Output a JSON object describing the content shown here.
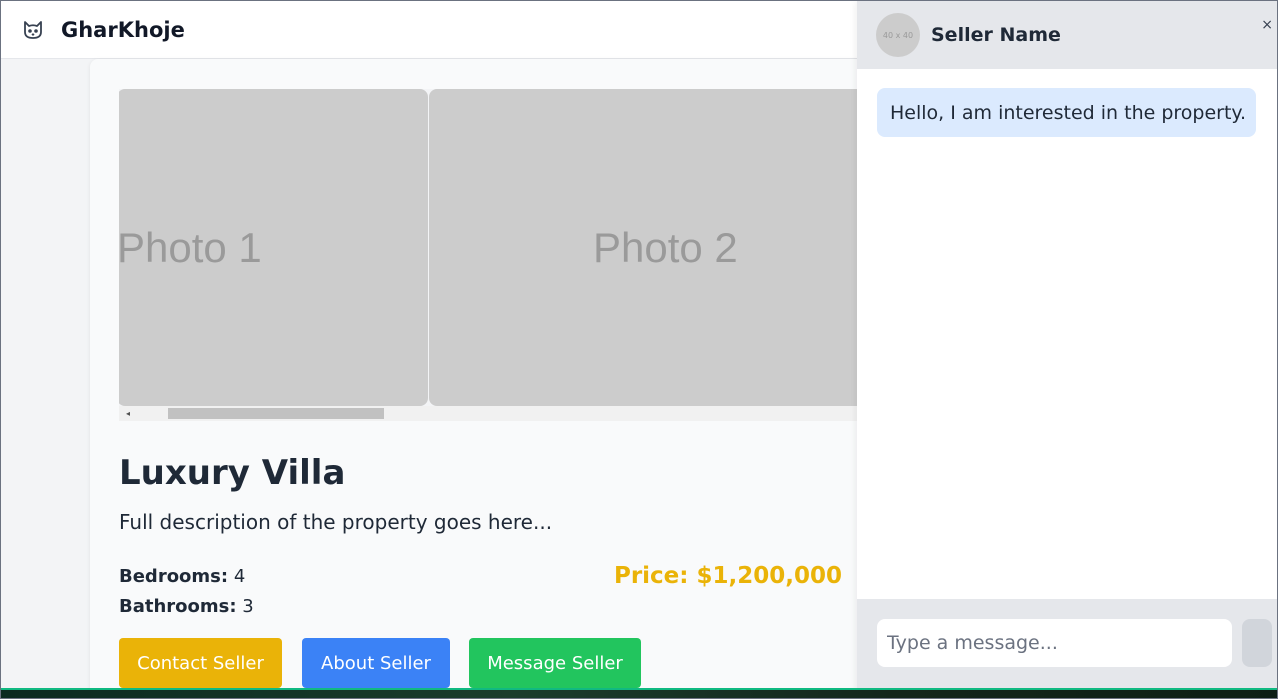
{
  "navbar": {
    "brand": "GharKhoje",
    "logo_icon": "cat-icon"
  },
  "gallery": {
    "photos": [
      {
        "label": "Photo 1"
      },
      {
        "label": "Photo 2"
      }
    ],
    "scroll_left_glyph": "◂"
  },
  "property": {
    "title": "Luxury Villa",
    "description": "Full description of the property goes here...",
    "bedrooms_label": "Bedrooms:",
    "bedrooms_value": "4",
    "bathrooms_label": "Bathrooms:",
    "bathrooms_value": "3",
    "price": "Price: $1,200,000",
    "price_color": "#eab308"
  },
  "actions": {
    "contact": "Contact Seller",
    "about": "About Seller",
    "message": "Message Seller"
  },
  "chat": {
    "avatar_text": "40 x 40",
    "seller_name": "Seller Name",
    "close": "×",
    "messages": [
      {
        "text": "Hello, I am interested in the property."
      }
    ],
    "input_placeholder": "Type a message..."
  }
}
